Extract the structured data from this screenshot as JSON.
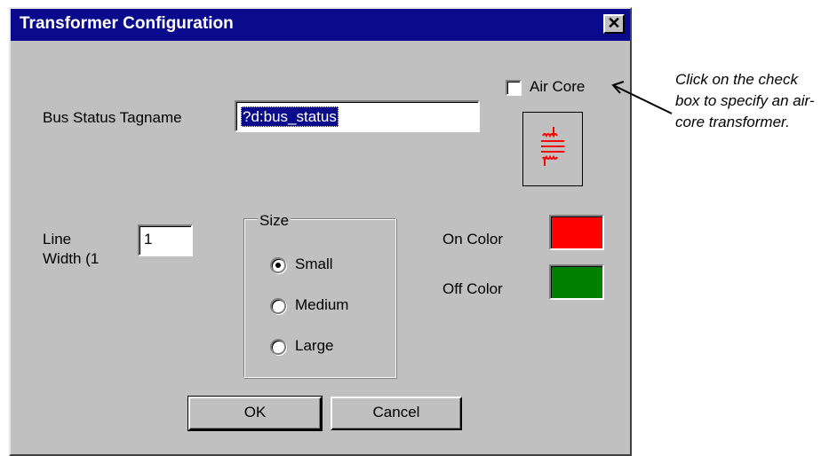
{
  "dialog": {
    "title": "Transformer Configuration",
    "close_symbol": "✕"
  },
  "bus_status": {
    "label": "Bus Status Tagname",
    "value": "?d:bus_status"
  },
  "air_core": {
    "label": "Air Core",
    "checked": false
  },
  "line_width": {
    "label_line1": "Line",
    "label_line2": "Width (1",
    "value": "1"
  },
  "size_group": {
    "legend": "Size",
    "options": [
      {
        "label": "Small",
        "selected": true
      },
      {
        "label": "Medium",
        "selected": false
      },
      {
        "label": "Large",
        "selected": false
      }
    ]
  },
  "colors": {
    "on_label": "On Color",
    "on_value": "#ff0000",
    "off_label": "Off Color",
    "off_value": "#008000",
    "symbol_color": "#ff0000"
  },
  "buttons": {
    "ok": "OK",
    "cancel": "Cancel"
  },
  "annotation": {
    "text": "Click on the check box to specify an air-core transformer."
  },
  "icons": {
    "close": "close-icon",
    "transformer": "transformer-symbol-icon",
    "arrow": "arrow-icon"
  }
}
